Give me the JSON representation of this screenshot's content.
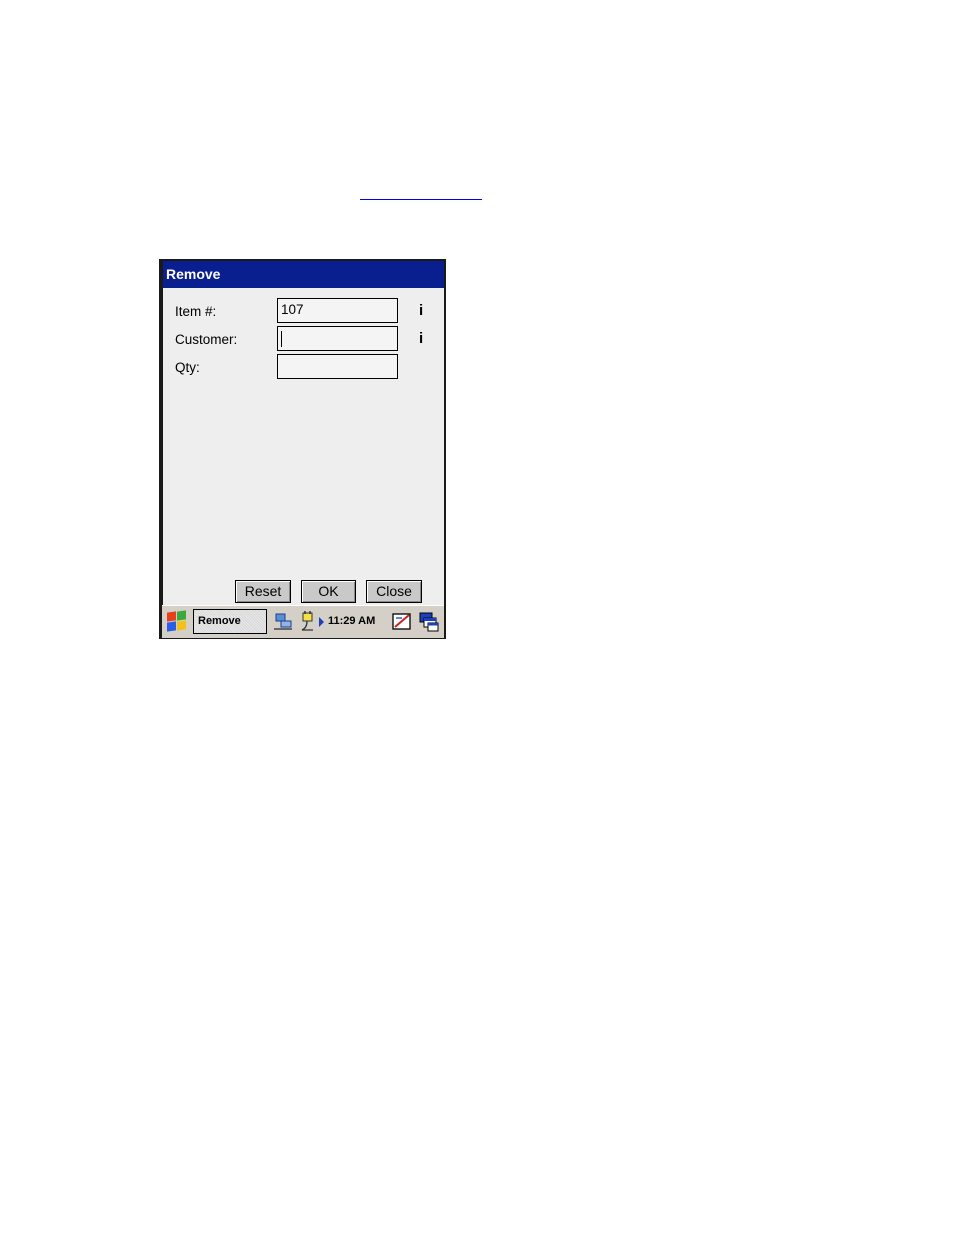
{
  "window": {
    "title": "Remove"
  },
  "form": {
    "item": {
      "label": "Item #:",
      "value": "107",
      "info": "i"
    },
    "customer": {
      "label": "Customer:",
      "value": "",
      "info": "i"
    },
    "qty": {
      "label": "Qty:",
      "value": ""
    }
  },
  "buttons": {
    "reset": "Reset",
    "ok": "OK",
    "close": "Close"
  },
  "taskbar": {
    "task_label": "Remove",
    "clock": "11:29 AM"
  },
  "colors": {
    "titlebar": "#0a1f8f",
    "window_bg": "#eeeeee",
    "link": "#0000ee"
  },
  "icons": [
    "windows-start-icon",
    "network-icon",
    "power-icon",
    "arrow-right-icon",
    "input-panel-icon",
    "desktop-switch-icon"
  ]
}
